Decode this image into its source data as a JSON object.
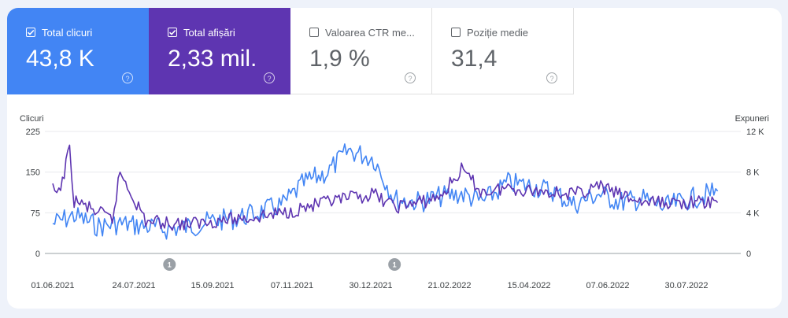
{
  "metrics": [
    {
      "label": "Total clicuri",
      "value": "43,8 K",
      "checked": true,
      "color": "#4285f4"
    },
    {
      "label": "Total afișări",
      "value": "2,33 mil.",
      "checked": true,
      "color": "#5e35b1"
    },
    {
      "label": "Valoarea CTR me...",
      "value": "1,9 %",
      "checked": false
    },
    {
      "label": "Poziție medie",
      "value": "31,4",
      "checked": false
    }
  ],
  "help_icon": "?",
  "chart_data": {
    "type": "line",
    "left_axis": {
      "title": "Clicuri",
      "ticks": [
        "0",
        "75",
        "150",
        "225"
      ],
      "ylim": [
        0,
        225
      ]
    },
    "right_axis": {
      "title": "Expuneri",
      "ticks": [
        "0",
        "4 K",
        "8 K",
        "12 K"
      ],
      "ylim": [
        0,
        12000
      ]
    },
    "x_ticks": [
      "01.06.2021",
      "24.07.2021",
      "15.09.2021",
      "07.11.2021",
      "30.12.2021",
      "21.02.2022",
      "15.04.2022",
      "07.06.2022",
      "30.07.2022"
    ],
    "annotations": [
      {
        "date": "17.08.2021",
        "label": "1"
      },
      {
        "date": "15.01.2022",
        "label": "1"
      }
    ],
    "grid": true,
    "series": [
      {
        "color": "#4285f4",
        "axis": "left",
        "x": [
          "01.06.2021",
          "15.06.2021",
          "01.07.2021",
          "15.07.2021",
          "01.08.2021",
          "15.08.2021",
          "01.09.2021",
          "15.09.2021",
          "01.10.2021",
          "15.10.2021",
          "01.11.2021",
          "15.11.2021",
          "01.12.2021",
          "15.12.2021",
          "01.01.2022",
          "15.01.2022",
          "01.02.2022",
          "15.02.2022",
          "01.03.2022",
          "15.03.2022",
          "01.04.2022",
          "15.04.2022",
          "01.05.2022",
          "15.05.2022",
          "01.06.2022",
          "15.06.2022",
          "01.07.2022",
          "15.07.2022",
          "01.08.2022",
          "20.08.2022"
        ],
        "y": [
          55,
          70,
          50,
          55,
          50,
          45,
          50,
          60,
          65,
          75,
          90,
          130,
          150,
          190,
          175,
          100,
          95,
          105,
          110,
          95,
          130,
          125,
          115,
          90,
          110,
          95,
          100,
          85,
          100,
          115
        ]
      },
      {
        "color": "#5e35b1",
        "axis": "right",
        "x": [
          "01.06.2021",
          "05.06.2021",
          "12.06.2021",
          "15.06.2021",
          "01.07.2021",
          "10.07.2021",
          "15.07.2021",
          "01.08.2021",
          "15.08.2021",
          "01.09.2021",
          "15.09.2021",
          "01.10.2021",
          "15.10.2021",
          "01.11.2021",
          "15.11.2021",
          "01.12.2021",
          "15.12.2021",
          "01.01.2022",
          "15.01.2022",
          "01.02.2022",
          "15.02.2022",
          "01.03.2022",
          "15.03.2022",
          "01.04.2022",
          "15.04.2022",
          "01.05.2022",
          "15.05.2022",
          "01.06.2022",
          "15.06.2022",
          "01.07.2022",
          "15.07.2022",
          "01.08.2022",
          "20.08.2022"
        ],
        "y": [
          6200,
          5800,
          10200,
          5200,
          4000,
          3300,
          8000,
          3200,
          3000,
          2900,
          3200,
          3400,
          3600,
          4000,
          4500,
          5000,
          5400,
          5800,
          4600,
          5000,
          5600,
          8200,
          6000,
          6500,
          6200,
          6100,
          5800,
          6600,
          5800,
          5000,
          5000,
          5000,
          5000
        ]
      }
    ]
  }
}
